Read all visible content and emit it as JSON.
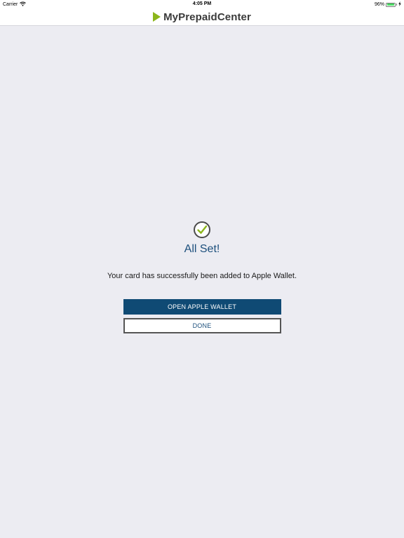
{
  "status_bar": {
    "carrier": "Carrier",
    "time": "4:05 PM",
    "battery_percent": "96%",
    "battery_level": 0.96
  },
  "header": {
    "brand_name": "MyPrepaidCenter"
  },
  "confirmation": {
    "icon": "check-circle-icon",
    "title": "All Set!",
    "message": "Your card has successfully been added to Apple Wallet."
  },
  "actions": {
    "open_wallet_label": "OPEN APPLE WALLET",
    "done_label": "DONE"
  },
  "colors": {
    "brand_green": "#8cb61b",
    "primary_blue": "#0f4a74",
    "title_blue": "#1c4f7c",
    "background": "#ececf2"
  }
}
